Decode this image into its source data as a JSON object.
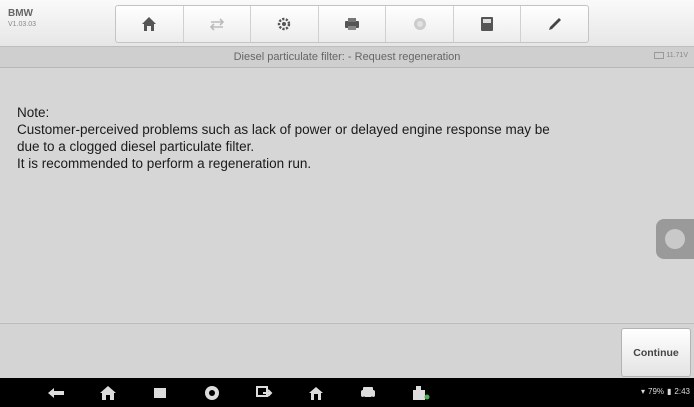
{
  "header": {
    "make": "BMW",
    "version": "V1.03.03"
  },
  "toolbar": {
    "tools": [
      {
        "icon": "home-icon",
        "enabled": true
      },
      {
        "icon": "vehicle-swap-icon",
        "enabled": false
      },
      {
        "icon": "settings-gear-icon",
        "enabled": true
      },
      {
        "icon": "print-icon",
        "enabled": true
      },
      {
        "icon": "help-icon",
        "enabled": false
      },
      {
        "icon": "save-icon",
        "enabled": true
      },
      {
        "icon": "pen-icon",
        "enabled": true
      }
    ]
  },
  "titlebar": {
    "title": "Diesel particulate filter: - Request regeneration",
    "voltage": "11.71V"
  },
  "note": {
    "heading": "Note:",
    "line1": "Customer-perceived problems such as lack of power or delayed engine response may be",
    "line2": "due to a clogged diesel particulate filter.",
    "line3": "It is recommended to perform a regeneration run."
  },
  "actions": {
    "continue_label": "Continue"
  },
  "navbar": {
    "icons": [
      "back-icon",
      "home-icon",
      "recent-apps-icon",
      "browser-icon",
      "screenshot-icon",
      "app-home-icon",
      "vehicle-icon",
      "vci-icon"
    ]
  },
  "status": {
    "battery": "79%",
    "time": "2:43"
  },
  "colors": {
    "background": "#d6d6d6",
    "navbar": "#000000",
    "text": "#1a1a1a"
  }
}
